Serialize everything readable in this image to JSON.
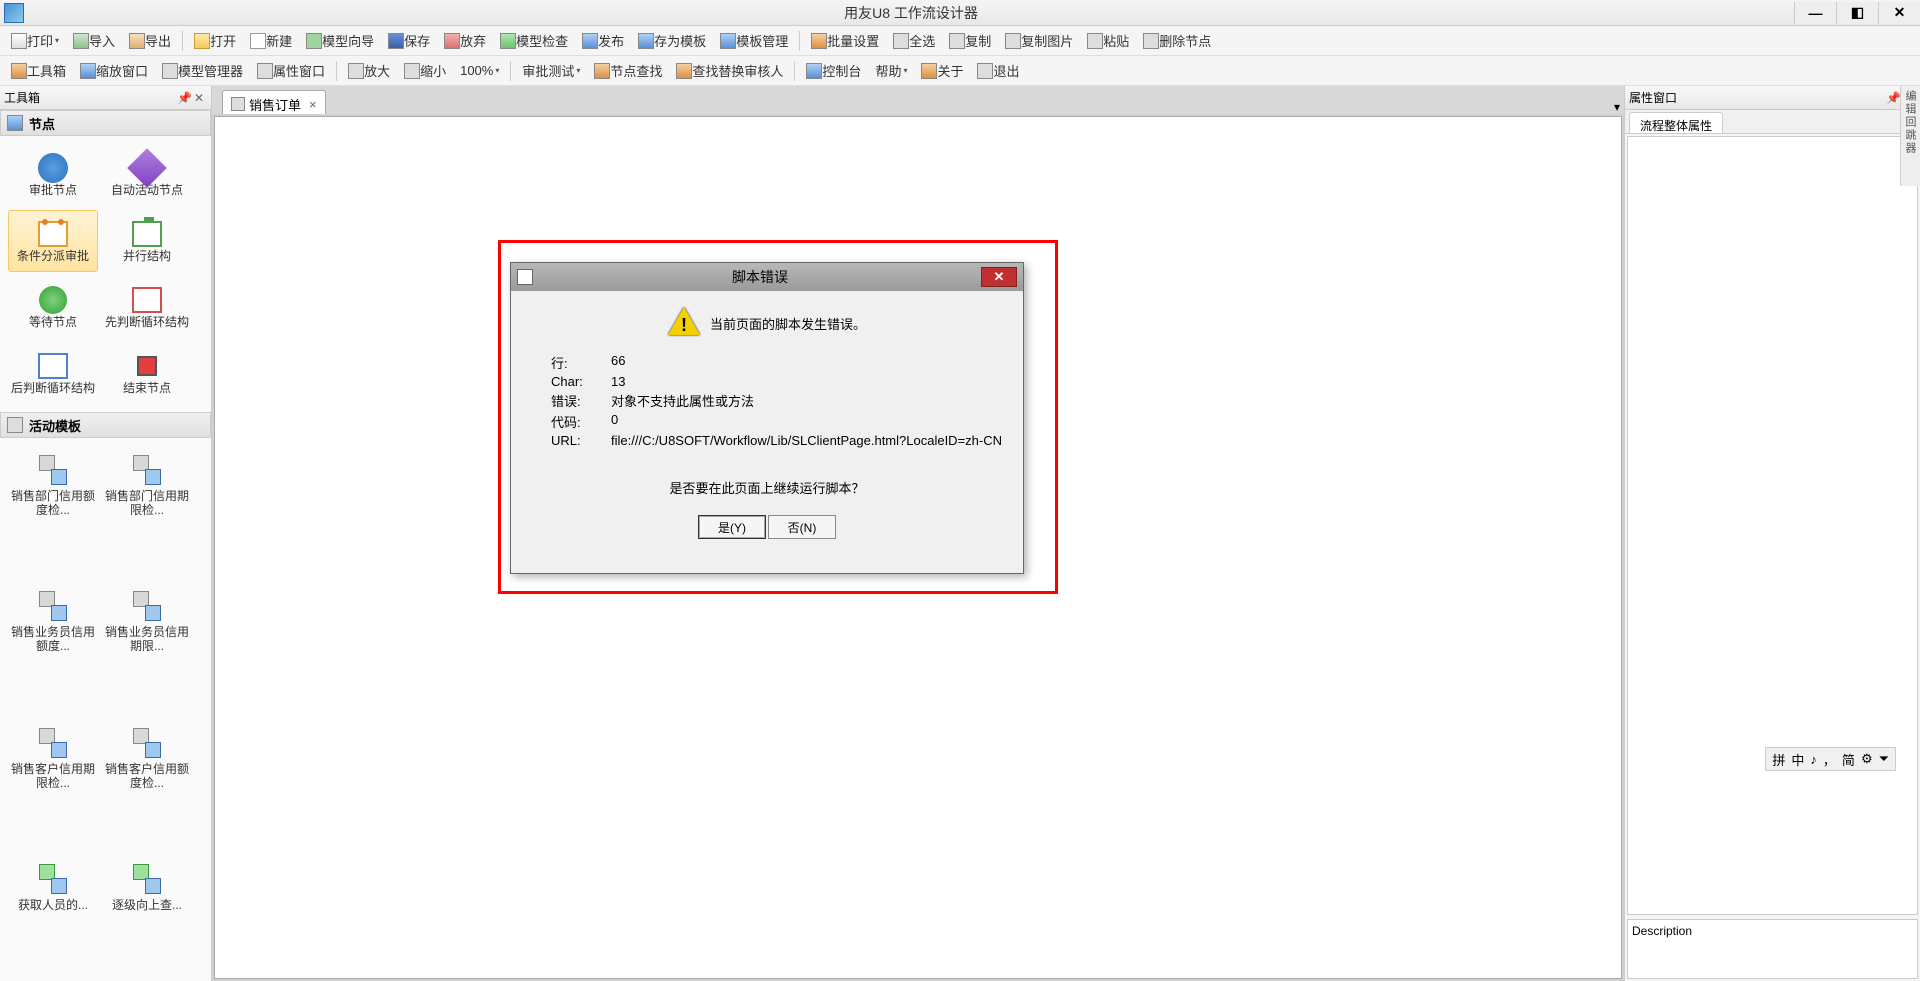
{
  "window": {
    "title": "用友U8 工作流设计器"
  },
  "toolbar1": {
    "print": "打印",
    "import": "导入",
    "export": "导出",
    "open": "打开",
    "new": "新建",
    "wizard": "模型向导",
    "save": "保存",
    "discard": "放弃",
    "check": "模型检查",
    "publish": "发布",
    "saveas_tpl": "存为模板",
    "tpl_mgr": "模板管理",
    "batch_set": "批量设置",
    "select_all": "全选",
    "copy": "复制",
    "copy_img": "复制图片",
    "paste": "粘贴",
    "del_node": "删除节点"
  },
  "toolbar2": {
    "toolbox": "工具箱",
    "zoom_win": "缩放窗口",
    "model_mgr": "模型管理器",
    "prop_win": "属性窗口",
    "zoom_in": "放大",
    "zoom_out": "缩小",
    "zoom_pct": "100%",
    "approve_test": "审批测试",
    "find_node": "节点查找",
    "find_replace_approver": "查找替换审核人",
    "console": "控制台",
    "help": "帮助",
    "about": "关于",
    "exit": "退出"
  },
  "left": {
    "panel_title": "工具箱",
    "section_nodes": "节点",
    "section_templates": "活动模板",
    "nodes": [
      {
        "label": "审批节点"
      },
      {
        "label": "自动活动节点"
      },
      {
        "label": "条件分派审批",
        "selected": true
      },
      {
        "label": "并行结构"
      },
      {
        "label": "等待节点"
      },
      {
        "label": "先判断循环结构"
      },
      {
        "label": "后判断循环结构"
      },
      {
        "label": "结束节点"
      }
    ],
    "templates": [
      {
        "label": "销售部门信用额度检..."
      },
      {
        "label": "销售部门信用期限检..."
      },
      {
        "label": "销售业务员信用额度..."
      },
      {
        "label": "销售业务员信用期限..."
      },
      {
        "label": "销售客户信用期限检..."
      },
      {
        "label": "销售客户信用额度检..."
      },
      {
        "label": "获取人员的..."
      },
      {
        "label": "逐级向上查..."
      }
    ]
  },
  "canvas": {
    "tab_label": "销售订单"
  },
  "right": {
    "panel_title": "属性窗口",
    "tab1": "流程整体属性",
    "desc_label": "Description",
    "strip_label": "编辑回跳器"
  },
  "ime": {
    "items": [
      "拼",
      "中",
      "♪",
      "，",
      "简",
      "⚙",
      "⏷"
    ]
  },
  "dialog": {
    "title": "脚本错误",
    "msg": "当前页面的脚本发生错误。",
    "rows": {
      "line_k": "行:",
      "line_v": "66",
      "char_k": "Char:",
      "char_v": "13",
      "err_k": "错误:",
      "err_v": "对象不支持此属性或方法",
      "code_k": "代码:",
      "code_v": "0",
      "url_k": "URL:",
      "url_v": "file:///C:/U8SOFT/Workflow/Lib/SLClientPage.html?LocaleID=zh-CN"
    },
    "question": "是否要在此页面上继续运行脚本？",
    "yes": "是(Y)",
    "no": "否(N)"
  }
}
